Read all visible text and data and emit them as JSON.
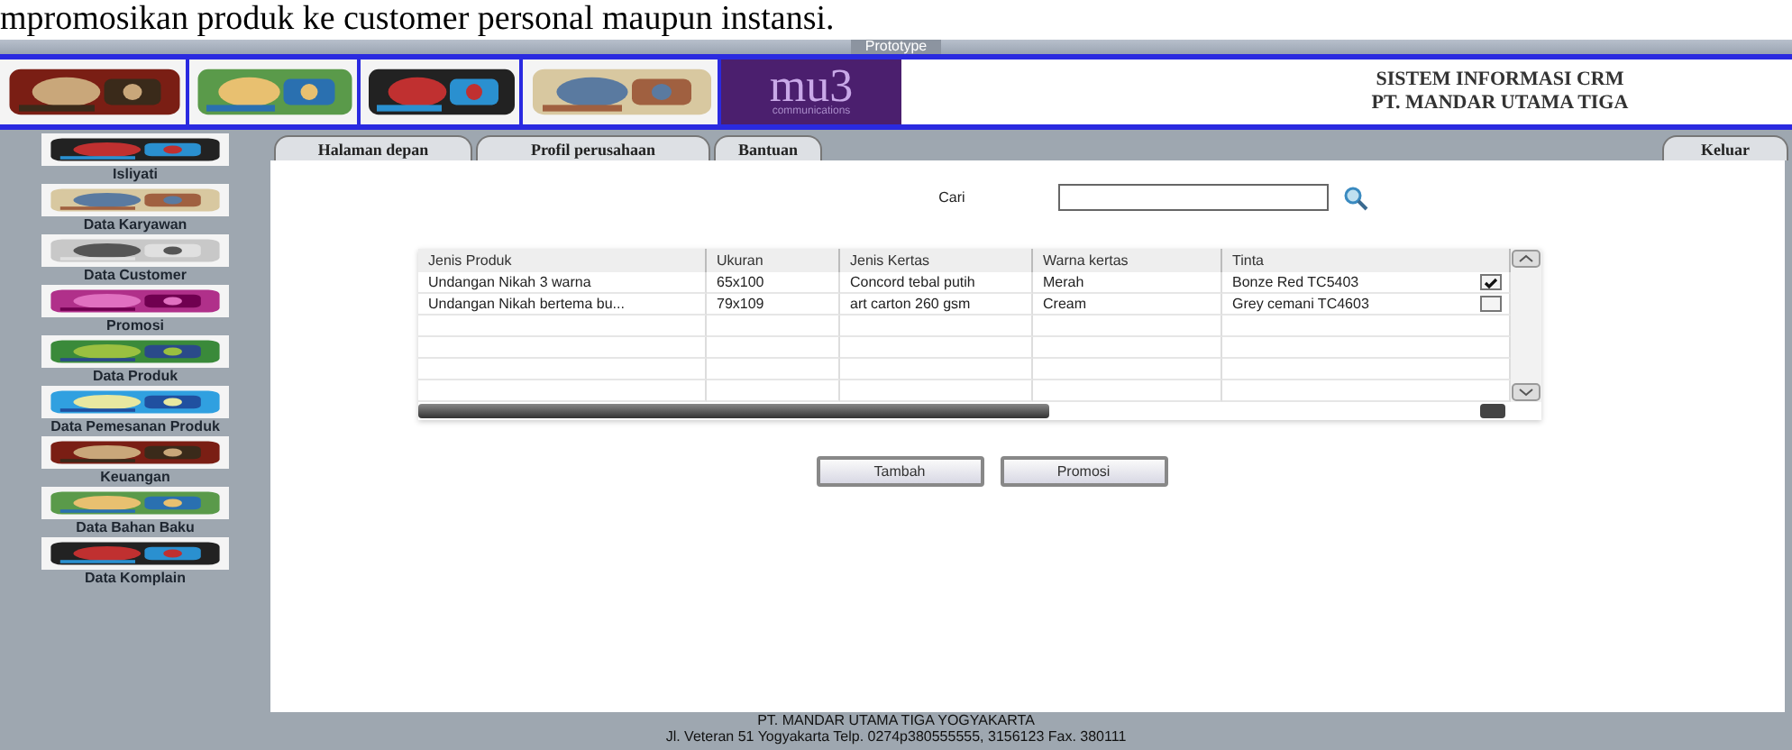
{
  "document_text": "mpromosikan produk ke customer personal maupun instansi.",
  "window": {
    "title_tab": "Prototype"
  },
  "header": {
    "title": "SISTEM INFORMASI CRM",
    "subtitle": "PT. MANDAR UTAMA TIGA",
    "logo_text": "mu3",
    "logo_subtext": "communications"
  },
  "nav_tabs": [
    {
      "label": "Halaman depan",
      "selected": false
    },
    {
      "label": "Profil perusahaan",
      "selected": false
    },
    {
      "label": "Bantuan",
      "selected": false
    }
  ],
  "logout_tab": {
    "label": "Keluar"
  },
  "sidebar": {
    "items": [
      {
        "label": "Isliyati"
      },
      {
        "label": "Data Karyawan"
      },
      {
        "label": "Data Customer"
      },
      {
        "label": "Promosi"
      },
      {
        "label": "Data Produk"
      },
      {
        "label": "Data Pemesanan Produk"
      },
      {
        "label": "Keuangan"
      },
      {
        "label": "Data Bahan Baku"
      },
      {
        "label": "Data Komplain"
      }
    ]
  },
  "search": {
    "label": "Cari"
  },
  "table": {
    "columns": [
      "Jenis Produk",
      "Ukuran",
      "Jenis Kertas",
      "Warna kertas",
      "Tinta"
    ],
    "rows": [
      {
        "cells": [
          "Undangan Nikah 3 warna",
          "65x100",
          "Concord tebal putih",
          "Merah",
          "Bonze Red TC5403"
        ],
        "checked": true
      },
      {
        "cells": [
          "Undangan Nikah bertema bu...",
          "79x109",
          "art carton 260 gsm",
          "Cream",
          "Grey cemani TC4603"
        ],
        "checked": false
      }
    ]
  },
  "buttons": [
    "Tambah",
    "Promosi"
  ],
  "footer": {
    "line_1": "PT. MANDAR UTAMA TIGA YOGYAKARTA",
    "line_2": "Jl. Veteran 51 Yogyakarta Telp. 0274p380555555, 3156123 Fax. 380111"
  }
}
